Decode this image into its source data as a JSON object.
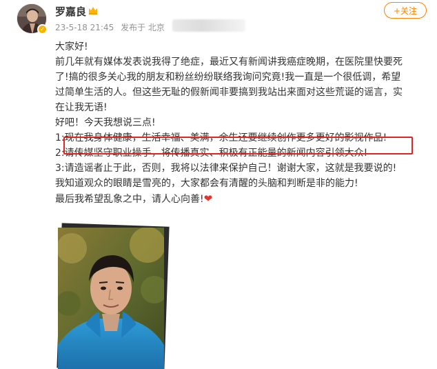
{
  "user": {
    "name": "罗嘉良",
    "timestamp": "23-5-18 21:45",
    "source": "发布于 北京"
  },
  "follow_button": {
    "label": "+关注"
  },
  "post": {
    "lines": [
      "大家好!",
      "前几年就有媒体发表说我得了绝症，最近又有新闻讲我癌症晚期，在医院里快要死",
      "了!搞的很多关心我的朋友和粉丝纷纷联络我询问究竟!我一直是一个很低调，希望",
      "过简单生活的人。但这些无耻的假新闻非要搞到我站出来面对这些荒诞的谣言，实",
      "在让我无语!",
      "好吧！今天我想说三点!",
      "1:现在我身体健康，生活幸福、美满，余生还要继续创作更多更好的影视作品!",
      "2:请传媒坚守职业操手，将传播真实、积极有正能量的新闻内容引领大众!",
      "3:请造谣者止于此，否则，我将以法律来保护自己！谢谢大家，这就是我要说的!",
      "我知道观众的眼睛是雪亮的，大家都会有清醒的头脑和判断是非的能力!",
      "最后我希望乱象之中，请人心向善!"
    ],
    "heart": "❤"
  },
  "icons": {
    "verified": "verified-badge-icon",
    "vip": "crown-icon",
    "heart": "heart-icon"
  },
  "colors": {
    "accent": "#ff8200",
    "highlight_border": "#e0241f",
    "meta_text": "#939393",
    "verified": "#f7b500"
  }
}
